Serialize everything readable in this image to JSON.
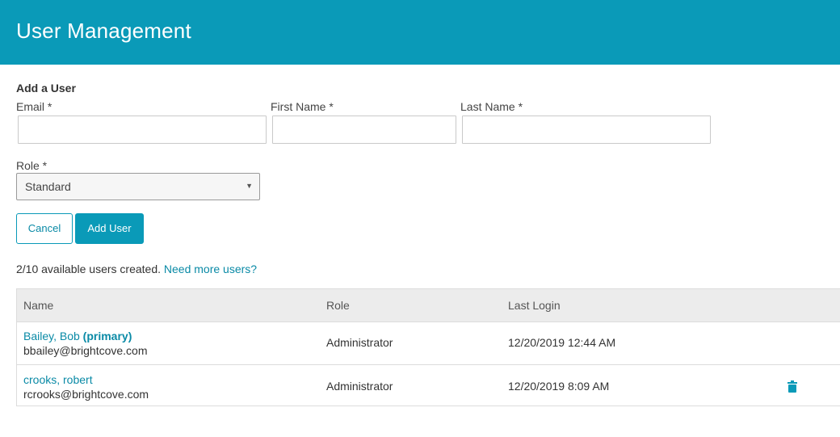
{
  "header": {
    "title": "User Management"
  },
  "form": {
    "section_title": "Add a User",
    "email": {
      "label": "Email *",
      "value": "",
      "placeholder": ""
    },
    "first_name": {
      "label": "First Name *",
      "value": "",
      "placeholder": ""
    },
    "last_name": {
      "label": "Last Name *",
      "value": "",
      "placeholder": ""
    },
    "role": {
      "label": "Role *",
      "selected": "Standard"
    },
    "cancel_label": "Cancel",
    "add_label": "Add User"
  },
  "availability": {
    "text": "2/10 available users created.",
    "link": "Need more users?"
  },
  "table": {
    "columns": [
      "Name",
      "Role",
      "Last Login"
    ],
    "rows": [
      {
        "name": "Bailey, Bob",
        "tag": "(primary)",
        "email": "bbailey@brightcove.com",
        "role": "Administrator",
        "last_login": "12/20/2019 12:44 AM",
        "delete_icon": false
      },
      {
        "name": "crooks, robert",
        "tag": "",
        "email": "rcrooks@brightcove.com",
        "role": "Administrator",
        "last_login": "12/20/2019 8:09 AM",
        "delete_icon": true
      }
    ]
  },
  "colors": {
    "accent": "#0a9ab8",
    "link": "#0a8aa6"
  },
  "icons": {
    "delete": "trash-icon",
    "select_arrow": "chevron-down-icon"
  }
}
